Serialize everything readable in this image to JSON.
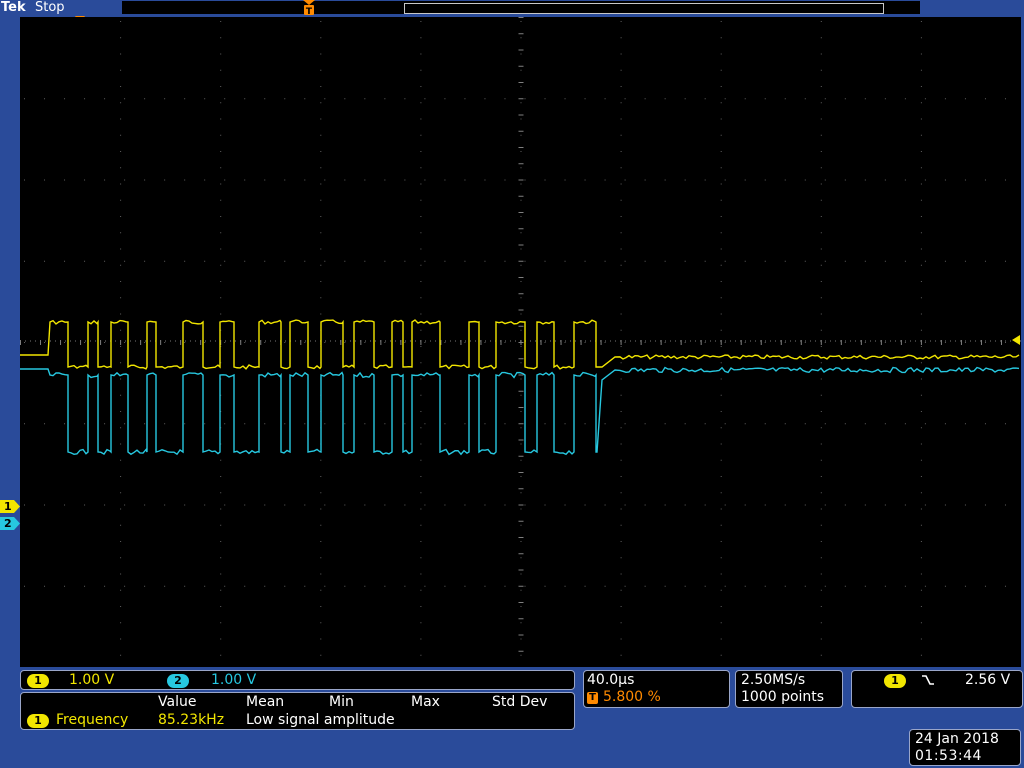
{
  "header": {
    "brand": "Tek",
    "run_state": "Stop",
    "trigger_marker_glyph": "T"
  },
  "channels": [
    {
      "id": "1",
      "color": "#f2e600",
      "scale": "1.00 V"
    },
    {
      "id": "2",
      "color": "#27c8e0",
      "scale": "1.00 V"
    }
  ],
  "measurement": {
    "columns": [
      "Value",
      "Mean",
      "Min",
      "Max",
      "Std Dev"
    ],
    "rows": [
      {
        "channel": "1",
        "name": "Frequency",
        "value": "85.23kHz",
        "status": "Low signal amplitude"
      }
    ]
  },
  "timebase": {
    "scale": "40.0µs",
    "trigger_position": "5.800 %"
  },
  "acquisition": {
    "sample_rate": "2.50MS/s",
    "record_length": "1000 points"
  },
  "trigger": {
    "source": "1",
    "slope_icon": "falling-edge-icon",
    "level": "2.56 V"
  },
  "datetime": {
    "date": "24 Jan  2018",
    "time": "01:53:44"
  },
  "colors": {
    "ch1": "#f2e600",
    "ch2": "#27c8e0",
    "trigger": "#ff8a00",
    "frame": "#2a4b9a"
  }
}
